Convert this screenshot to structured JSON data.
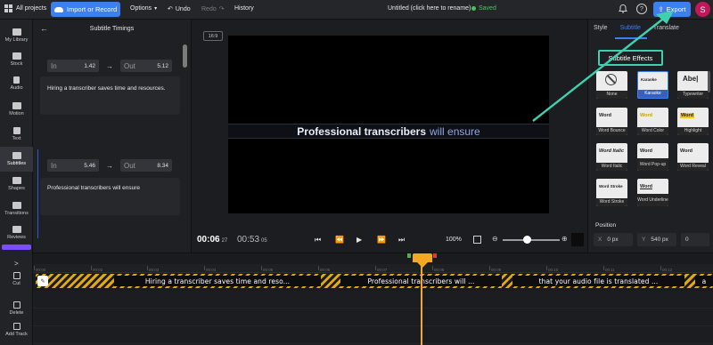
{
  "topbar": {
    "all_projects": "All projects",
    "import_label": "Import or Record",
    "options_label": "Options",
    "undo_label": "Undo",
    "redo_label": "Redo",
    "history_label": "History",
    "project_title": "Untitled (click here to rename)",
    "saved_label": "Saved",
    "help_glyph": "?",
    "export_label": "Export",
    "avatar_initial": "S",
    "accent_color": "#3d7ff0"
  },
  "rail": {
    "items": [
      {
        "label": "My Library",
        "icon": "folder-icon"
      },
      {
        "label": "Stock",
        "icon": "stock-icon"
      },
      {
        "label": "Audio",
        "icon": "music-note-icon"
      },
      {
        "label": "Motion",
        "icon": "motion-icon"
      },
      {
        "label": "Text",
        "icon": "text-icon"
      },
      {
        "label": "Subtitles",
        "icon": "subtitles-icon"
      },
      {
        "label": "Shapes",
        "icon": "shapes-icon"
      },
      {
        "label": "Transitions",
        "icon": "transitions-icon"
      },
      {
        "label": "Reviews",
        "icon": "reviews-icon"
      }
    ],
    "active": "Subtitles"
  },
  "subtitle_panel": {
    "title": "Subtitle Timings",
    "in_label": "In",
    "out_label": "Out",
    "arrow_glyph": "→",
    "entries": [
      {
        "in": "1.42",
        "out": "5.12",
        "text": "Hiring a transcriber saves time and resources."
      },
      {
        "in": "5.46",
        "out": "8.34",
        "text": "Professional transcribers will ensure"
      }
    ]
  },
  "preview": {
    "aspect_ratio": "16:9",
    "subtitle_highlight": "Professional transcribers",
    "subtitle_rest": "will ensure",
    "current_time": "00:06",
    "current_frames": "27",
    "total_time": "00:53",
    "total_frames": "05",
    "zoom_level": "100%"
  },
  "right_panel": {
    "tabs": [
      "Style",
      "Subtitle",
      "Translate"
    ],
    "active_tab": "Subtitle",
    "effects_title": "Subtitle Effects",
    "effects": [
      {
        "label": "None",
        "preview": ""
      },
      {
        "label": "Karaoke",
        "preview": "Karaoke"
      },
      {
        "label": "Typewriter",
        "preview": "Abe|"
      },
      {
        "label": "Word Bounce",
        "preview": "Word"
      },
      {
        "label": "Word Color",
        "preview": "Word"
      },
      {
        "label": "Highlight",
        "preview": "Word"
      },
      {
        "label": "Word Italic",
        "preview": "Word Italic"
      },
      {
        "label": "Word Pop-up",
        "preview": "Word"
      },
      {
        "label": "Word Reveal",
        "preview": "Word"
      },
      {
        "label": "Word Stroke",
        "preview": "Word Stroke"
      },
      {
        "label": "Word Underline",
        "preview": "Word"
      }
    ],
    "selected_effect": "Karaoke",
    "position_label": "Position",
    "x_key": "X",
    "x_value": "0 px",
    "y_key": "Y",
    "y_value": "540 px",
    "z_value": "0",
    "highlight_color": "#3ed1b0"
  },
  "timeline": {
    "tools": [
      {
        "label": "Cut",
        "icon": "scissors-icon"
      },
      {
        "label": "Delete",
        "icon": "trash-icon"
      },
      {
        "label": "Add Track",
        "icon": "add-track-icon"
      }
    ],
    "chevron_glyph": ">",
    "ruler": [
      "00:00",
      "00:02",
      "00:03",
      "00:04",
      "00:05",
      "00:06",
      "00:07",
      "00:08",
      "00:09",
      "00:10",
      "00:11",
      "00:12"
    ],
    "clips": [
      "Hiring a transcriber saves time and reso...",
      "Professional transcribers will ...",
      "that your audio file is translated ...",
      "a"
    ],
    "playhead_color": "#f5a623"
  }
}
